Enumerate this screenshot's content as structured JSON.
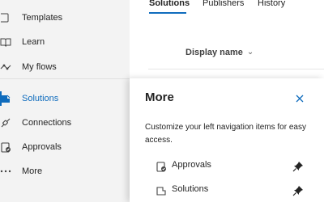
{
  "nav": {
    "items": [
      {
        "label": "Templates",
        "icon": "templates-icon",
        "active": false
      },
      {
        "label": "Learn",
        "icon": "book-icon",
        "active": false
      },
      {
        "label": "My flows",
        "icon": "flow-icon",
        "active": false
      },
      {
        "label": "Solutions",
        "icon": "solutions-icon",
        "active": true
      },
      {
        "label": "Connections",
        "icon": "connections-icon",
        "active": false
      },
      {
        "label": "Approvals",
        "icon": "approvals-icon",
        "active": false
      },
      {
        "label": "More",
        "icon": "more-icon",
        "active": false
      }
    ],
    "accent_color": "#0f6cbd"
  },
  "main": {
    "tabs": [
      {
        "label": "Solutions",
        "selected": true
      },
      {
        "label": "Publishers",
        "selected": false
      },
      {
        "label": "History",
        "selected": false
      }
    ],
    "column_header": "Display name"
  },
  "panel": {
    "title": "More",
    "description": "Customize your left navigation items for easy access.",
    "items": [
      {
        "label": "Approvals",
        "icon": "approvals-icon",
        "pinned": true
      },
      {
        "label": "Solutions",
        "icon": "solutions-icon",
        "pinned": true
      }
    ]
  }
}
